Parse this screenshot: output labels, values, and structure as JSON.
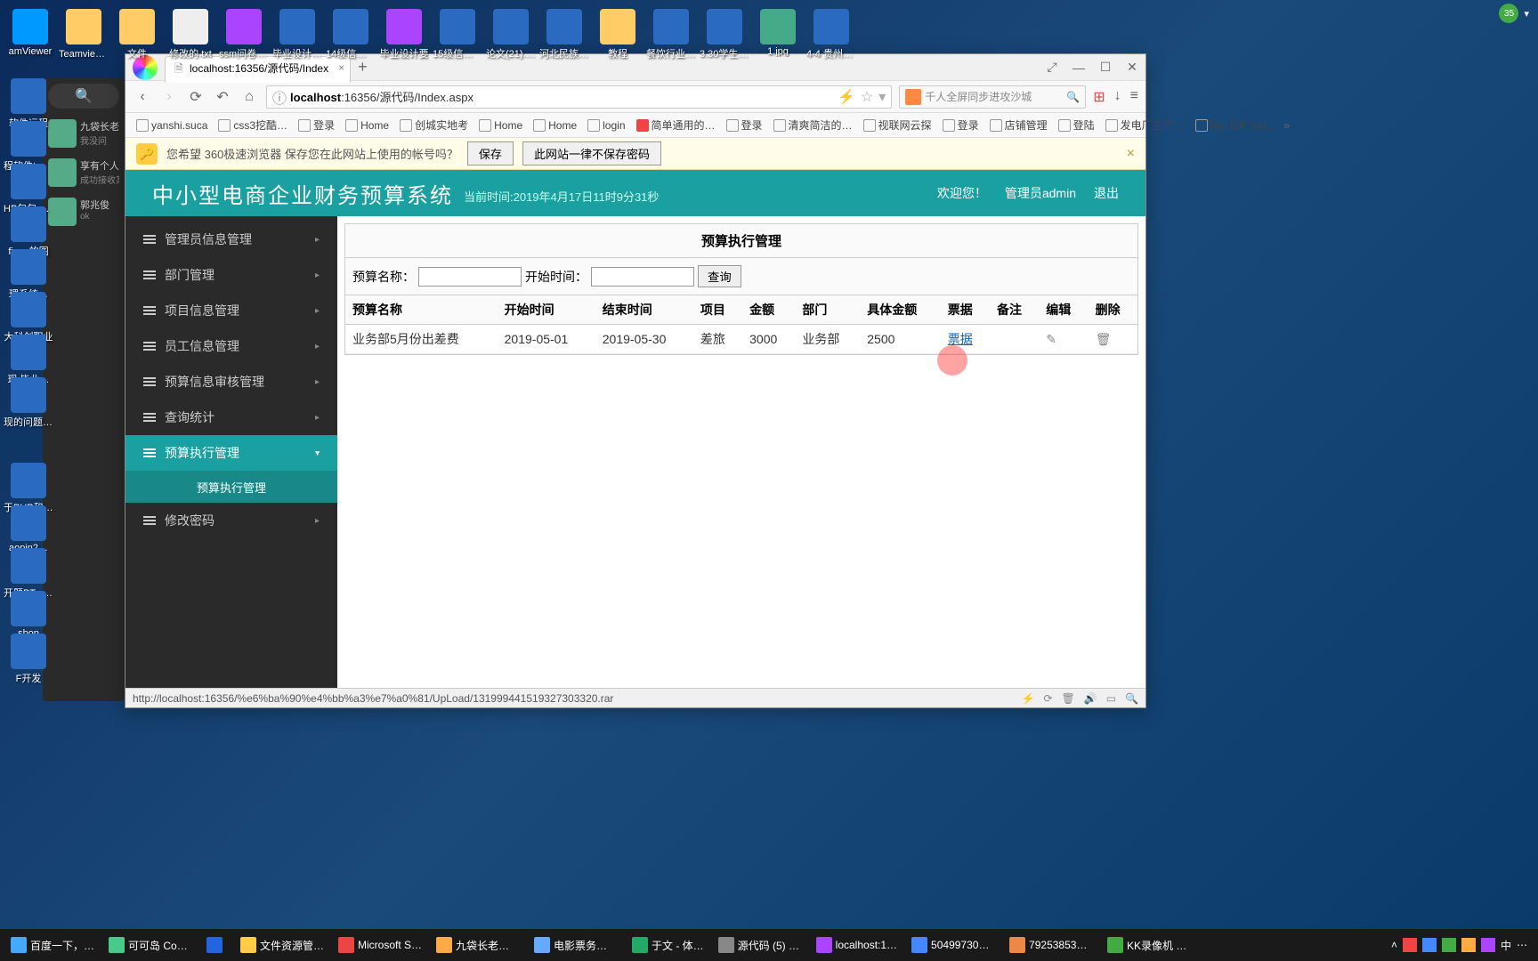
{
  "desktop_icons_row1": [
    {
      "label": "amViewer",
      "type": "app"
    },
    {
      "label": "Teamviewer (远程软件…",
      "type": "folder"
    },
    {
      "label": "文件",
      "type": "folder"
    },
    {
      "label": "修改的.txt",
      "type": "txt"
    },
    {
      "label": "ssm问卷调…",
      "type": "rar"
    },
    {
      "label": "毕业设计说明",
      "type": "doc"
    },
    {
      "label": "14级信管专",
      "type": "doc"
    },
    {
      "label": "毕业设计要",
      "type": "rar"
    },
    {
      "label": "15级信管1班",
      "type": "doc"
    },
    {
      "label": "论文(21).doc",
      "type": "doc"
    },
    {
      "label": "河北民族师范",
      "type": "doc"
    },
    {
      "label": "教程",
      "type": "folder"
    },
    {
      "label": "餐饮行业从业",
      "type": "doc"
    },
    {
      "label": "3.30学生考试",
      "type": "doc"
    },
    {
      "label": "1.jpg",
      "type": "img"
    },
    {
      "label": "4-4 贵州官兴",
      "type": "doc"
    }
  ],
  "chat": {
    "items": [
      {
        "name": "九袋长老",
        "msg": "我没问"
      },
      {
        "name": "享有个人",
        "msg": "成功接收某"
      },
      {
        "name": "郭兆俊",
        "msg": "ok"
      }
    ]
  },
  "browser": {
    "tab_title": "localhost:16356/源代码/Index",
    "url_host": "localhost",
    "url_path": ":16356/源代码/Index.aspx",
    "search_placeholder": "千人全屏同步进攻沙城",
    "bookmarks": [
      "yanshi.suca",
      "css3挖酷…",
      "登录",
      "Home",
      "创城实地考",
      "Home",
      "Home",
      "login",
      "简单通用的…",
      "登录",
      "清爽简洁的…",
      "视联网云探",
      "登录",
      "店铺管理",
      "登陆",
      "发电厂生产…",
      "My JSP 'ind…"
    ],
    "savebar_text": "您希望 360极速浏览器 保存您在此网站上使用的帐号吗？",
    "savebar_btn1": "保存",
    "savebar_btn2": "此网站一律不保存密码",
    "status_url": "http://localhost:16356/%e6%ba%90%e4%bb%a3%e7%a0%81/UpLoad/131999441519327303320.rar"
  },
  "app": {
    "title": "中小型电商企业财务预算系统",
    "time_label": "当前时间:2019年4月17日11时9分31秒",
    "welcome": "欢迎您！",
    "admin": "管理员admin",
    "logout": "退出",
    "menu": [
      "管理员信息管理",
      "部门管理",
      "项目信息管理",
      "员工信息管理",
      "预算信息审核管理",
      "查询统计",
      "预算执行管理",
      "修改密码"
    ],
    "submenu_active": "预算执行管理",
    "panel_title": "预算执行管理",
    "filter_label1": "预算名称：",
    "filter_label2": "开始时间：",
    "filter_btn": "查询",
    "columns": [
      "预算名称",
      "开始时间",
      "结束时间",
      "项目",
      "金额",
      "部门",
      "具体金额",
      "票据",
      "备注",
      "编辑",
      "删除"
    ],
    "row": {
      "name": "业务部5月份出差费",
      "start": "2019-05-01",
      "end": "2019-05-30",
      "project": "差旅",
      "amount": "3000",
      "dept": "业务部",
      "actual": "2500",
      "receipt": "票据",
      "remark": ""
    }
  },
  "taskbar": {
    "items": [
      "百度一下，…",
      "可可岛 Coc…",
      "",
      "文件资源管…",
      "Microsoft S…",
      "九袋长老等3…",
      "电影票务等9…",
      "于文 - 体…",
      "源代码 (5) -…",
      "localhost:1…",
      "504997304…",
      "792538535…",
      "KK录像机 0…"
    ],
    "tray_text": "中"
  },
  "top_badge": "35"
}
